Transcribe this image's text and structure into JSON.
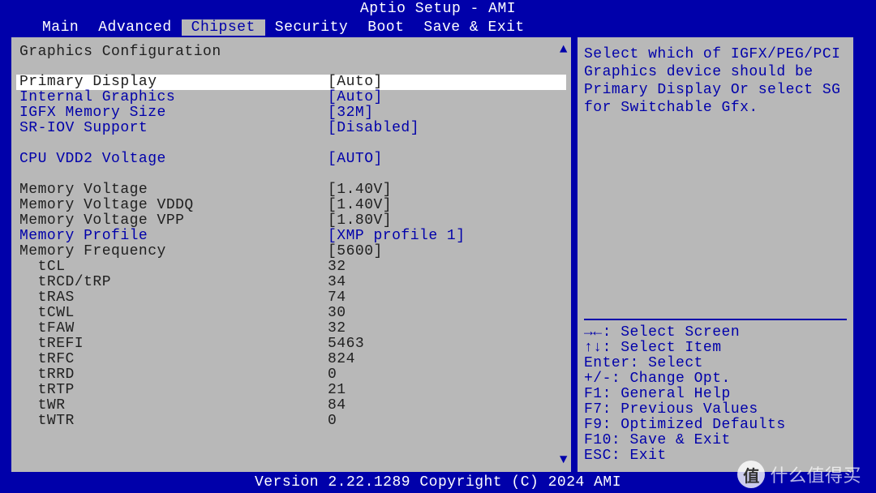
{
  "title": "Aptio Setup - AMI",
  "menu": {
    "items": [
      "Main",
      "Advanced",
      "Chipset",
      "Security",
      "Boot",
      "Save & Exit"
    ],
    "active_index": 2
  },
  "section_title": "Graphics Configuration",
  "rows": [
    {
      "label": "Primary Display",
      "value": "[Auto]",
      "style": "selected",
      "selectable": true
    },
    {
      "label": "Internal Graphics",
      "value": "[Auto]",
      "style": "blue",
      "selectable": true
    },
    {
      "label": "IGFX Memory Size",
      "value": "[32M]",
      "style": "blue",
      "selectable": true
    },
    {
      "label": "SR-IOV Support",
      "value": "[Disabled]",
      "style": "blue",
      "selectable": true
    },
    {
      "spacer": true
    },
    {
      "label": "CPU VDD2 Voltage",
      "value": "[AUTO]",
      "style": "blue",
      "selectable": true
    },
    {
      "spacer": true
    },
    {
      "label": "Memory Voltage",
      "value": "[1.40V]",
      "style": "dark",
      "selectable": false
    },
    {
      "label": "Memory Voltage VDDQ",
      "value": "[1.40V]",
      "style": "dark",
      "selectable": false
    },
    {
      "label": "Memory Voltage VPP",
      "value": "[1.80V]",
      "style": "dark",
      "selectable": false
    },
    {
      "label": "Memory Profile",
      "value": "[XMP profile 1]",
      "style": "blue",
      "selectable": true
    },
    {
      "label": "Memory Frequency",
      "value": "[5600]",
      "style": "dark",
      "selectable": false
    },
    {
      "label": "  tCL",
      "value": "32",
      "style": "dark",
      "selectable": false
    },
    {
      "label": "  tRCD/tRP",
      "value": "34",
      "style": "dark",
      "selectable": false
    },
    {
      "label": "  tRAS",
      "value": "74",
      "style": "dark",
      "selectable": false
    },
    {
      "label": "  tCWL",
      "value": "30",
      "style": "dark",
      "selectable": false
    },
    {
      "label": "  tFAW",
      "value": "32",
      "style": "dark",
      "selectable": false
    },
    {
      "label": "  tREFI",
      "value": "5463",
      "style": "dark",
      "selectable": false
    },
    {
      "label": "  tRFC",
      "value": "824",
      "style": "dark",
      "selectable": false
    },
    {
      "label": "  tRRD",
      "value": "0",
      "style": "dark",
      "selectable": false
    },
    {
      "label": "  tRTP",
      "value": "21",
      "style": "dark",
      "selectable": false
    },
    {
      "label": "  tWR",
      "value": "84",
      "style": "dark",
      "selectable": false
    },
    {
      "label": "  tWTR",
      "value": "0",
      "style": "dark",
      "selectable": false
    }
  ],
  "help_text": "Select which of IGFX/PEG/PCI Graphics device should be Primary Display Or select SG for Switchable Gfx.",
  "key_help": [
    "→←: Select Screen",
    "↑↓: Select Item",
    "Enter: Select",
    "+/-: Change Opt.",
    "F1: General Help",
    "F7: Previous Values",
    "F9: Optimized Defaults",
    "F10: Save & Exit",
    "ESC: Exit"
  ],
  "footer": "Version 2.22.1289 Copyright (C) 2024 AMI",
  "watermark": "什么值得买",
  "watermark_badge": "值"
}
